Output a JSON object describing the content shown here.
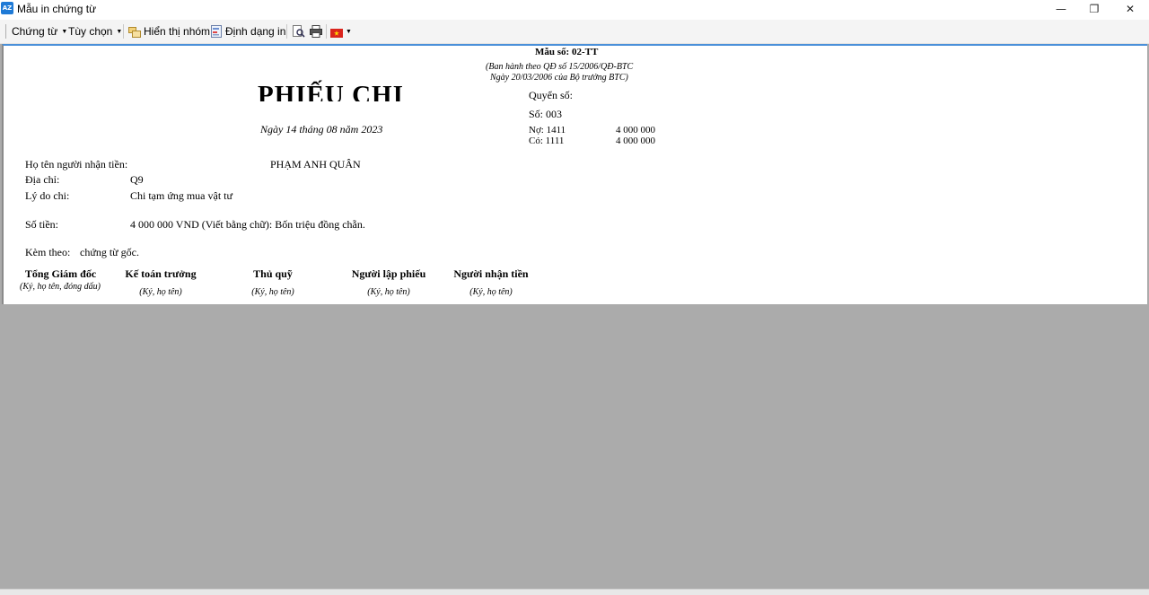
{
  "window": {
    "title": "Mẫu in chứng từ",
    "icon_text": "AZ",
    "minimize_glyph": "—",
    "restore_glyph": "❐",
    "close_glyph": "✕"
  },
  "toolbar": {
    "chung_tu": "Chứng từ",
    "tuy_chon": "Tùy chọn",
    "hien_thi_nhom": "Hiển thị nhóm",
    "dinh_dang_in": "Định dạng in",
    "caret": "▼"
  },
  "voucher": {
    "form_no": "Mẫu số: 02-TT",
    "issued_line1": "(Ban hành theo QĐ số 15/2006/QĐ-BTC",
    "issued_line2": "Ngày 20/03/2006 của Bộ trưởng BTC)",
    "title": "PHIẾU CHI",
    "date": "Ngày 14 tháng 08 năm 2023",
    "book_label": "Quyển số:",
    "number": "Số: 003",
    "debit_account": "Nợ: 1411",
    "debit_amount": "4 000 000",
    "credit_account": "Có: 1111",
    "credit_amount": "4 000 000",
    "recipient_label": "Họ tên người nhận tiền:",
    "recipient_value": "PHẠM ANH QUÂN",
    "address_label": "Địa chỉ:",
    "address_value": "Q9",
    "reason_label": "Lý do chi:",
    "reason_value": "Chi tạm ứng mua vật tư",
    "amount_label": "Số tiền:",
    "amount_value": "4 000 000 VND (Viết bằng chữ): Bốn triệu đồng chẵn.",
    "attached_label": "Kèm theo:",
    "attached_value": "chứng từ gốc.",
    "signatures": [
      {
        "title": "Tổng Giám đốc",
        "note": "(Ký, họ tên, đóng dấu)"
      },
      {
        "title": "Kế toán trưởng",
        "note": "(Ký, họ tên)"
      },
      {
        "title": "Thủ quỹ",
        "note": "(Ký, họ tên)"
      },
      {
        "title": "Người lập phiếu",
        "note": "(Ký, họ tên)"
      },
      {
        "title": "Người nhận tiền",
        "note": "(Ký, họ tên)"
      }
    ]
  },
  "colors": {
    "viewer_background": "#ababab",
    "accent": "#4a90d9",
    "flag_red": "#da251d",
    "flag_star": "#ffdd00"
  }
}
